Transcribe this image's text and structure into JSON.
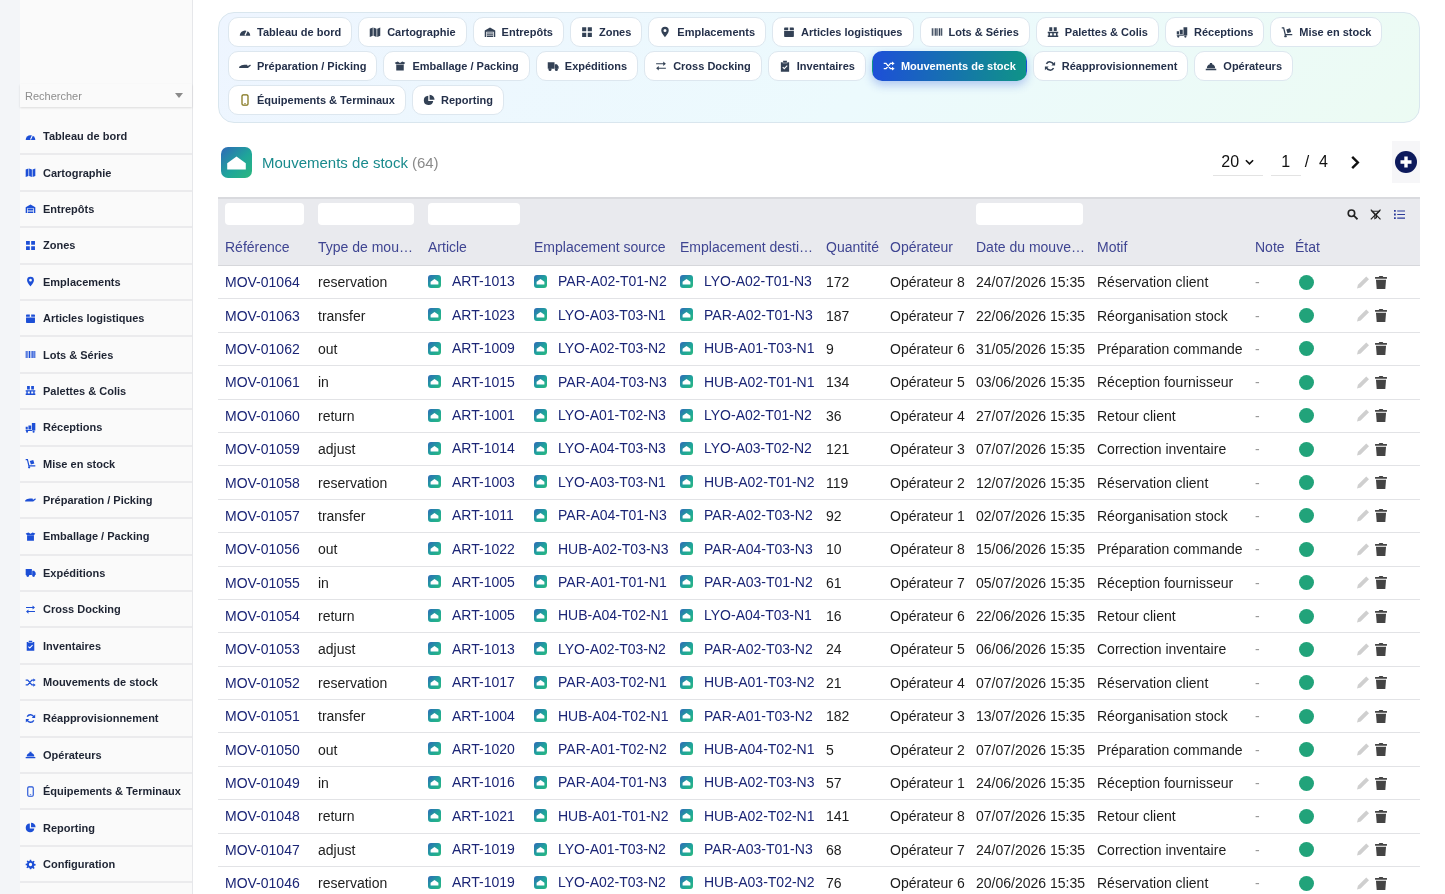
{
  "sidebar": {
    "search": {
      "placeholder": "Rechercher"
    },
    "items": [
      "Tableau de bord",
      "Cartographie",
      "Entrepôts",
      "Zones",
      "Emplacements",
      "Articles logistiques",
      "Lots & Séries",
      "Palettes & Colis",
      "Réceptions",
      "Mise en stock",
      "Préparation / Picking",
      "Emballage / Packing",
      "Expéditions",
      "Cross Docking",
      "Inventaires",
      "Mouvements de stock",
      "Réapprovisionnement",
      "Opérateurs",
      "Équipements & Terminaux",
      "Reporting",
      "Configuration"
    ]
  },
  "nav": {
    "tabs": [
      {
        "label": "Tableau de bord",
        "selected": false
      },
      {
        "label": "Cartographie",
        "selected": false
      },
      {
        "label": "Entrepôts",
        "selected": false
      },
      {
        "label": "Zones",
        "selected": false
      },
      {
        "label": "Emplacements",
        "selected": false
      },
      {
        "label": "Articles logistiques",
        "selected": false
      },
      {
        "label": "Lots & Séries",
        "selected": false
      },
      {
        "label": "Palettes & Colis",
        "selected": false
      },
      {
        "label": "Réceptions",
        "selected": false
      },
      {
        "label": "Mise en stock",
        "selected": false
      },
      {
        "label": "Préparation / Picking",
        "selected": false
      },
      {
        "label": "Emballage / Packing",
        "selected": false
      },
      {
        "label": "Expéditions",
        "selected": false
      },
      {
        "label": "Cross Docking",
        "selected": false
      },
      {
        "label": "Inventaires",
        "selected": false
      },
      {
        "label": "Mouvements de stock",
        "selected": true
      },
      {
        "label": "Réapprovisionnement",
        "selected": false
      },
      {
        "label": "Opérateurs",
        "selected": false
      },
      {
        "label": "Équipements & Terminaux",
        "selected": false
      },
      {
        "label": "Reporting",
        "selected": false
      }
    ]
  },
  "header": {
    "title": "Mouvements de stock",
    "count": "(64)",
    "page_size": "20",
    "page": "1",
    "separator": "/",
    "page_count": "4"
  },
  "table": {
    "columns": [
      {
        "label": "Référence",
        "filter": true
      },
      {
        "label": "Type de mou…",
        "filter": true
      },
      {
        "label": "Article",
        "filter": true
      },
      {
        "label": "Emplacement source",
        "filter": false
      },
      {
        "label": "Emplacement desti…",
        "filter": false
      },
      {
        "label": "Quantité",
        "filter": false
      },
      {
        "label": "Opérateur",
        "filter": false
      },
      {
        "label": "Date du mouve…",
        "filter": true
      },
      {
        "label": "Motif",
        "filter": false
      },
      {
        "label": "Note",
        "filter": false
      },
      {
        "label": "État",
        "filter": false
      }
    ],
    "rows": [
      {
        "reference": "MOV-01064",
        "type": "reservation",
        "article": "ART-1013",
        "source": "PAR-A02-T01-N2",
        "destination": "LYO-A02-T01-N3",
        "quantity": "172",
        "operator": "Opérateur 8",
        "date": "24/07/2026 15:35",
        "reason": "Réservation client",
        "note": "-",
        "active": true
      },
      {
        "reference": "MOV-01063",
        "type": "transfer",
        "article": "ART-1023",
        "source": "LYO-A03-T03-N1",
        "destination": "PAR-A02-T01-N3",
        "quantity": "187",
        "operator": "Opérateur 7",
        "date": "22/06/2026 15:35",
        "reason": "Réorganisation stock",
        "note": "-",
        "active": true
      },
      {
        "reference": "MOV-01062",
        "type": "out",
        "article": "ART-1009",
        "source": "LYO-A02-T03-N2",
        "destination": "HUB-A01-T03-N1",
        "quantity": "9",
        "operator": "Opérateur 6",
        "date": "31/05/2026 15:35",
        "reason": "Préparation commande",
        "note": "-",
        "active": true
      },
      {
        "reference": "MOV-01061",
        "type": "in",
        "article": "ART-1015",
        "source": "PAR-A04-T03-N3",
        "destination": "HUB-A02-T01-N1",
        "quantity": "134",
        "operator": "Opérateur 5",
        "date": "03/06/2026 15:35",
        "reason": "Réception fournisseur",
        "note": "-",
        "active": true
      },
      {
        "reference": "MOV-01060",
        "type": "return",
        "article": "ART-1001",
        "source": "LYO-A01-T02-N3",
        "destination": "LYO-A02-T01-N2",
        "quantity": "36",
        "operator": "Opérateur 4",
        "date": "27/07/2026 15:35",
        "reason": "Retour client",
        "note": "-",
        "active": true
      },
      {
        "reference": "MOV-01059",
        "type": "adjust",
        "article": "ART-1014",
        "source": "LYO-A04-T03-N3",
        "destination": "LYO-A03-T02-N2",
        "quantity": "121",
        "operator": "Opérateur 3",
        "date": "07/07/2026 15:35",
        "reason": "Correction inventaire",
        "note": "-",
        "active": true
      },
      {
        "reference": "MOV-01058",
        "type": "reservation",
        "article": "ART-1003",
        "source": "LYO-A03-T03-N1",
        "destination": "HUB-A02-T01-N2",
        "quantity": "119",
        "operator": "Opérateur 2",
        "date": "12/07/2026 15:35",
        "reason": "Réservation client",
        "note": "-",
        "active": true
      },
      {
        "reference": "MOV-01057",
        "type": "transfer",
        "article": "ART-1011",
        "source": "PAR-A04-T01-N3",
        "destination": "PAR-A02-T03-N2",
        "quantity": "92",
        "operator": "Opérateur 1",
        "date": "02/07/2026 15:35",
        "reason": "Réorganisation stock",
        "note": "-",
        "active": true
      },
      {
        "reference": "MOV-01056",
        "type": "out",
        "article": "ART-1022",
        "source": "HUB-A02-T03-N3",
        "destination": "PAR-A04-T03-N3",
        "quantity": "10",
        "operator": "Opérateur 8",
        "date": "15/06/2026 15:35",
        "reason": "Préparation commande",
        "note": "-",
        "active": true
      },
      {
        "reference": "MOV-01055",
        "type": "in",
        "article": "ART-1005",
        "source": "PAR-A01-T01-N1",
        "destination": "PAR-A03-T01-N2",
        "quantity": "61",
        "operator": "Opérateur 7",
        "date": "05/07/2026 15:35",
        "reason": "Réception fournisseur",
        "note": "-",
        "active": true
      },
      {
        "reference": "MOV-01054",
        "type": "return",
        "article": "ART-1005",
        "source": "HUB-A04-T02-N1",
        "destination": "LYO-A04-T03-N1",
        "quantity": "16",
        "operator": "Opérateur 6",
        "date": "22/06/2026 15:35",
        "reason": "Retour client",
        "note": "-",
        "active": true
      },
      {
        "reference": "MOV-01053",
        "type": "adjust",
        "article": "ART-1013",
        "source": "LYO-A02-T03-N2",
        "destination": "PAR-A02-T03-N2",
        "quantity": "24",
        "operator": "Opérateur 5",
        "date": "06/06/2026 15:35",
        "reason": "Correction inventaire",
        "note": "-",
        "active": true
      },
      {
        "reference": "MOV-01052",
        "type": "reservation",
        "article": "ART-1017",
        "source": "PAR-A03-T02-N1",
        "destination": "HUB-A01-T03-N2",
        "quantity": "21",
        "operator": "Opérateur 4",
        "date": "07/07/2026 15:35",
        "reason": "Réservation client",
        "note": "-",
        "active": true
      },
      {
        "reference": "MOV-01051",
        "type": "transfer",
        "article": "ART-1004",
        "source": "HUB-A04-T02-N1",
        "destination": "PAR-A01-T03-N2",
        "quantity": "182",
        "operator": "Opérateur 3",
        "date": "13/07/2026 15:35",
        "reason": "Réorganisation stock",
        "note": "-",
        "active": true
      },
      {
        "reference": "MOV-01050",
        "type": "out",
        "article": "ART-1020",
        "source": "PAR-A01-T02-N2",
        "destination": "HUB-A04-T02-N1",
        "quantity": "5",
        "operator": "Opérateur 2",
        "date": "07/07/2026 15:35",
        "reason": "Préparation commande",
        "note": "-",
        "active": true
      },
      {
        "reference": "MOV-01049",
        "type": "in",
        "article": "ART-1016",
        "source": "PAR-A04-T01-N3",
        "destination": "HUB-A02-T03-N3",
        "quantity": "57",
        "operator": "Opérateur 1",
        "date": "24/06/2026 15:35",
        "reason": "Réception fournisseur",
        "note": "-",
        "active": true
      },
      {
        "reference": "MOV-01048",
        "type": "return",
        "article": "ART-1021",
        "source": "HUB-A01-T01-N2",
        "destination": "HUB-A02-T02-N1",
        "quantity": "141",
        "operator": "Opérateur 8",
        "date": "07/07/2026 15:35",
        "reason": "Retour client",
        "note": "-",
        "active": true
      },
      {
        "reference": "MOV-01047",
        "type": "adjust",
        "article": "ART-1019",
        "source": "LYO-A01-T03-N2",
        "destination": "PAR-A03-T01-N3",
        "quantity": "68",
        "operator": "Opérateur 7",
        "date": "24/07/2026 15:35",
        "reason": "Correction inventaire",
        "note": "-",
        "active": true
      },
      {
        "reference": "MOV-01046",
        "type": "reservation",
        "article": "ART-1019",
        "source": "LYO-A02-T03-N2",
        "destination": "HUB-A03-T02-N2",
        "quantity": "76",
        "operator": "Opérateur 6",
        "date": "20/06/2026 15:35",
        "reason": "Réservation client",
        "note": "-",
        "active": true
      }
    ]
  }
}
